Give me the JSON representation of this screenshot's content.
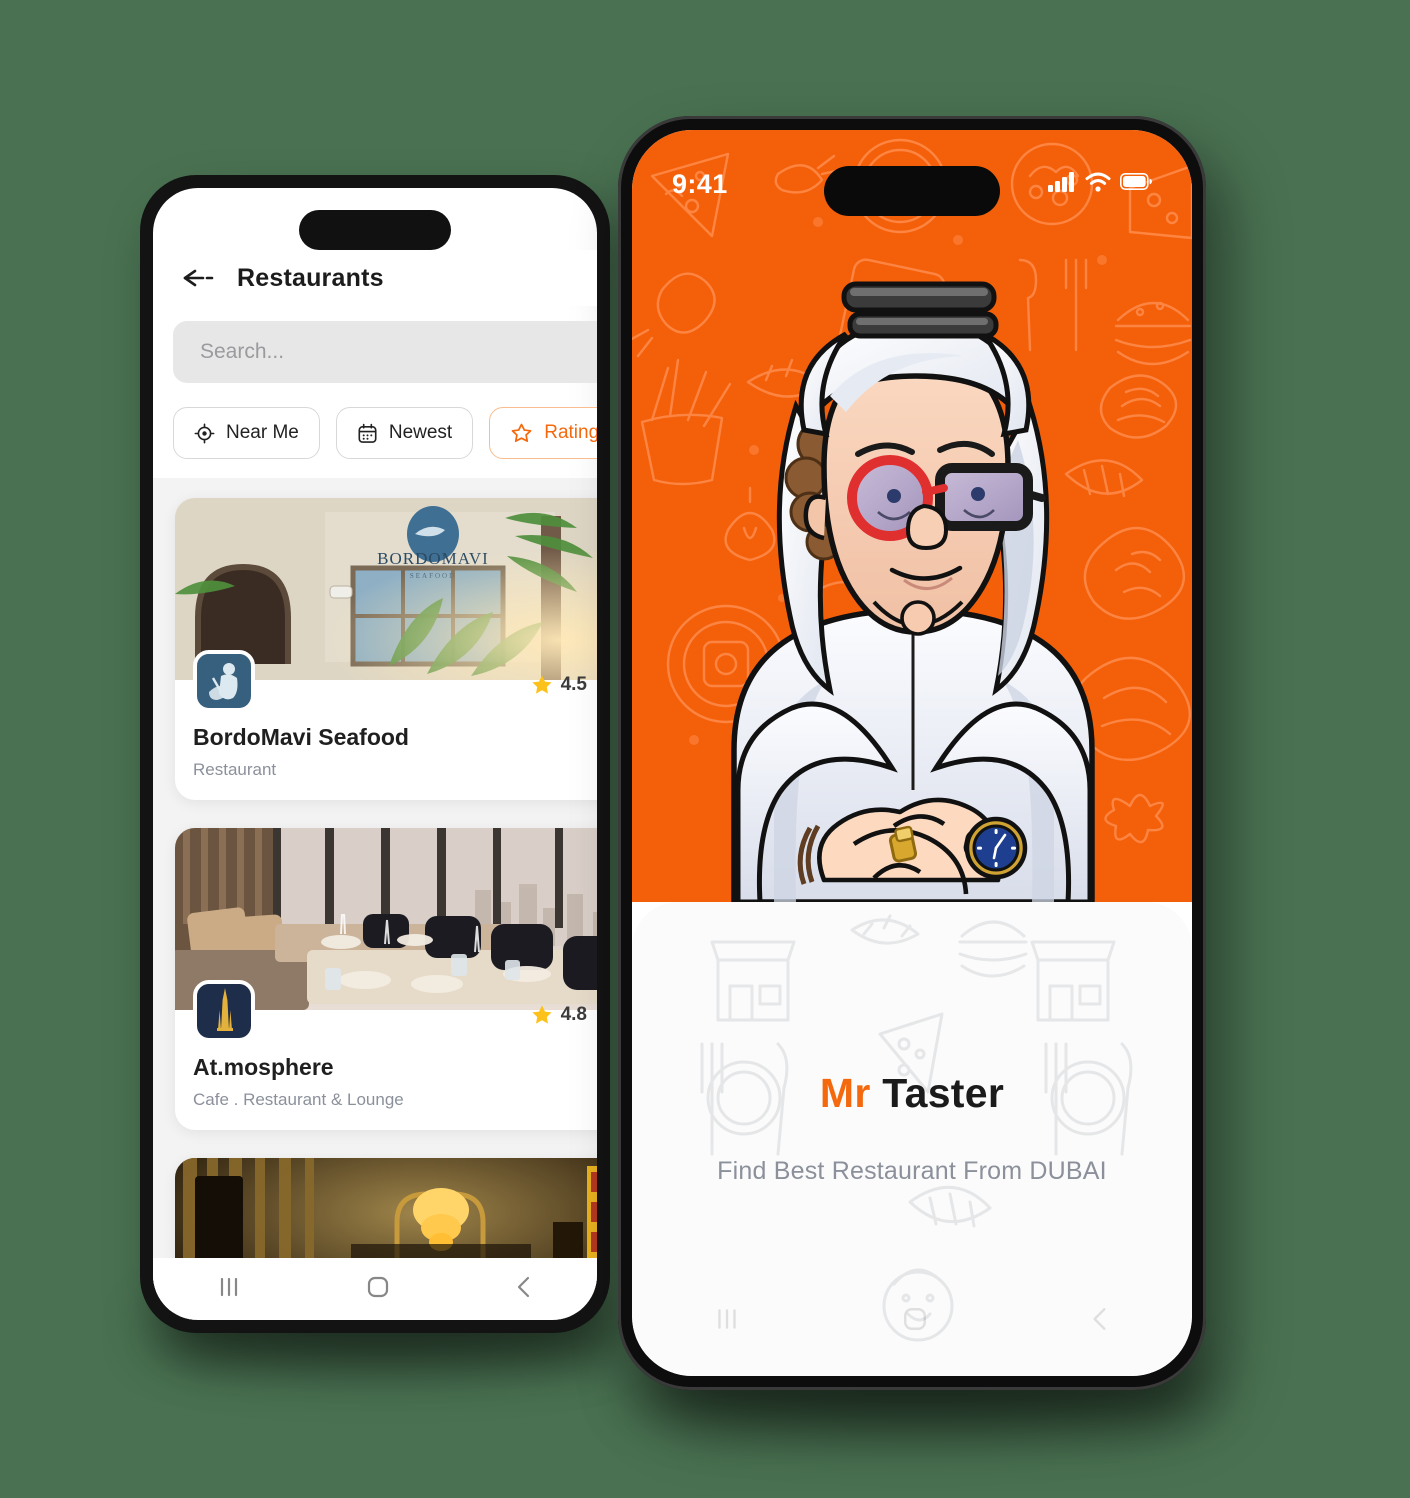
{
  "page": {
    "background_color": "#4a7252",
    "brand_orange": "#f4600a"
  },
  "back_phone": {
    "platform": "android",
    "header": {
      "back_icon": "arrow-left-icon",
      "title": "Restaurants"
    },
    "search": {
      "placeholder": "Search...",
      "value": ""
    },
    "filters": [
      {
        "label": "Near Me",
        "icon": "target-location-icon",
        "active": false
      },
      {
        "label": "Newest",
        "icon": "calendar-icon",
        "active": false
      },
      {
        "label": "Rating",
        "icon": "star-outline-icon",
        "active": true
      },
      {
        "label": "",
        "icon": "filter-funnel-icon",
        "active": true
      }
    ],
    "restaurants": [
      {
        "name": "BordoMavi Seafood",
        "category": "Restaurant",
        "rating": "4.5",
        "logo_name": "bordomavi-fisherman-logo",
        "photo_name": "bordomavi-storefront-photo"
      },
      {
        "name": "At.mosphere",
        "category": "Cafe . Restaurant & Lounge",
        "rating": "4.8",
        "logo_name": "burj-khalifa-logo",
        "photo_name": "atmosphere-dining-room-photo"
      },
      {
        "name": "",
        "category": "",
        "rating": "",
        "logo_name": "",
        "photo_name": "gold-bar-lounge-photo"
      }
    ],
    "navbar": [
      {
        "icon": "recents-icon"
      },
      {
        "icon": "home-icon"
      },
      {
        "icon": "back-chevron-icon"
      }
    ]
  },
  "front_phone": {
    "platform": "ios",
    "status_bar": {
      "time": "9:41",
      "icons": [
        "cellular-signal-icon",
        "wifi-icon",
        "battery-icon"
      ]
    },
    "hero": {
      "background_color": "#f4600a",
      "illustration_name": "mr-taster-character-illustration",
      "pattern_name": "food-doodle-pattern"
    },
    "splash": {
      "brand_first": "Mr",
      "brand_second": "Taster",
      "tagline": "Find Best Restaurant From DUBAI"
    },
    "navbar": [
      {
        "icon": "recents-icon"
      },
      {
        "icon": "home-icon"
      },
      {
        "icon": "back-chevron-icon"
      }
    ]
  }
}
